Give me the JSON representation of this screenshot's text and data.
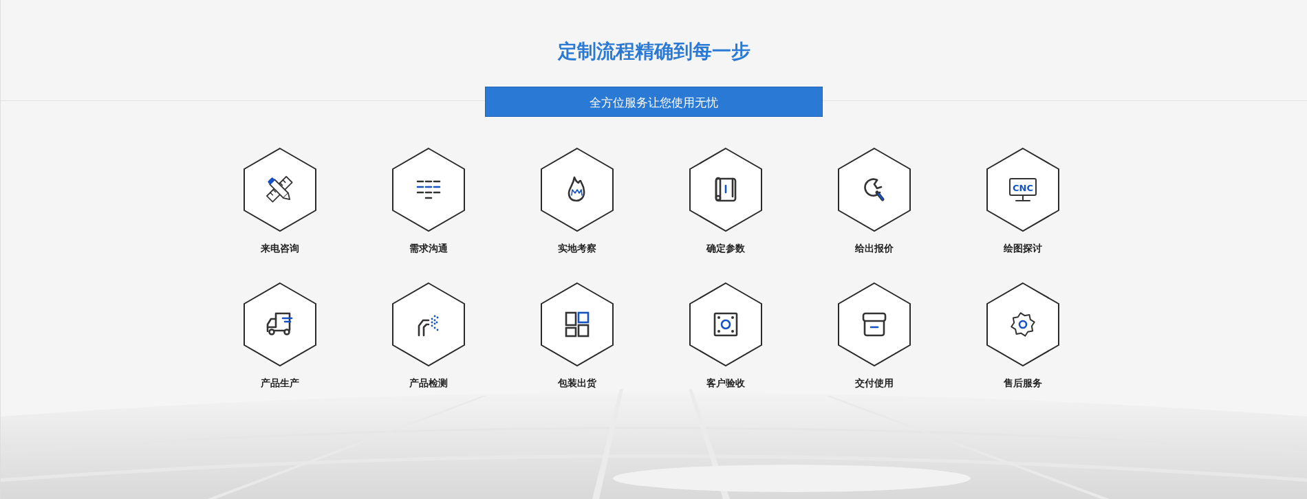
{
  "title": "定制流程精确到每一步",
  "subtitle": "全方位服务让您使用无忧",
  "steps": [
    {
      "label": "来电咨询"
    },
    {
      "label": "需求沟通"
    },
    {
      "label": "实地考察"
    },
    {
      "label": "确定参数"
    },
    {
      "label": "给出报价"
    },
    {
      "label": "绘图探讨",
      "icon_text": "CNC"
    },
    {
      "label": "产品生产"
    },
    {
      "label": "产品检测"
    },
    {
      "label": "包装出货"
    },
    {
      "label": "客户验收"
    },
    {
      "label": "交付使用"
    },
    {
      "label": "售后服务"
    }
  ]
}
